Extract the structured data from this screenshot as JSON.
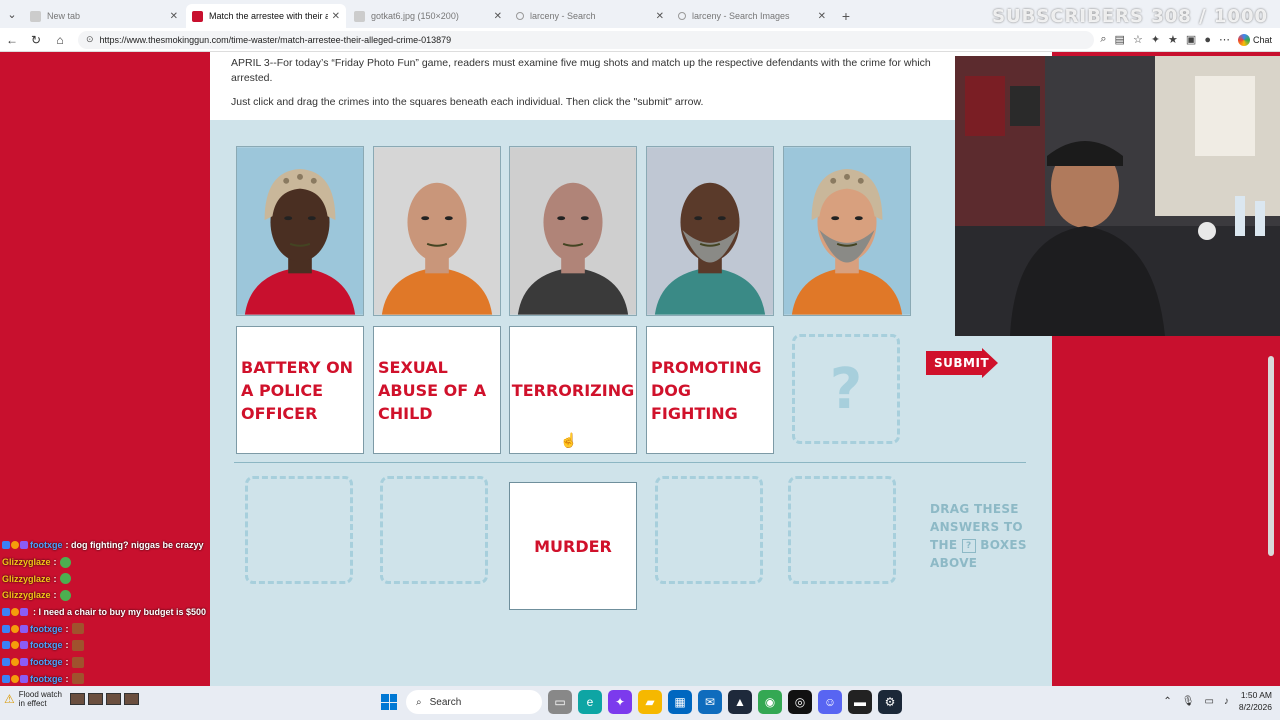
{
  "browser": {
    "tabs": [
      {
        "label": "New tab",
        "icon": "blank-page-icon",
        "active": false
      },
      {
        "label": "Match the arrestee with their alleg",
        "icon": "tsg-favicon",
        "active": true
      },
      {
        "label": "gotkat6.jpg (150×200)",
        "icon": "image-icon",
        "active": false
      },
      {
        "label": "larceny - Search",
        "icon": "search-icon",
        "active": false
      },
      {
        "label": "larceny - Search Images",
        "icon": "search-icon",
        "active": false
      }
    ],
    "url": "https://www.thesmokinggun.com/time-waster/match-arrestee-their-alleged-crime-013879",
    "chat_label": "Chat"
  },
  "stream_overlay": {
    "subscribers": "SUBSCRIBERS 308 / 1000"
  },
  "article": {
    "intro": "APRIL 3--For today’s “Friday Photo Fun” game, readers must examine five mug shots and match up the respective defendants with the crime for which arrested.",
    "instructions": "Just click and drag the crimes into the squares beneath each individual. Then click the \"submit\" arrow."
  },
  "game": {
    "mugshots": [
      {
        "name": "mugshot-1",
        "background": "#9cc6da",
        "skin": "#4a2f22",
        "shirt": "#c8102e",
        "helmet": true,
        "beard": false
      },
      {
        "name": "mugshot-2",
        "background": "#d6d6d6",
        "skin": "#c9967a",
        "shirt": "#e07828",
        "helmet": false,
        "beard": false
      },
      {
        "name": "mugshot-3",
        "background": "#cfcfcf",
        "skin": "#b08478",
        "shirt": "#3a3a3a",
        "helmet": false,
        "beard": false
      },
      {
        "name": "mugshot-4",
        "background": "#bfc7d3",
        "skin": "#5a3a2a",
        "shirt": "#3a8a86",
        "helmet": false,
        "beard": true
      },
      {
        "name": "mugshot-5",
        "background": "#9cc6da",
        "skin": "#d8a07e",
        "shirt": "#e07828",
        "helmet": true,
        "beard": true
      }
    ],
    "crimes": [
      "BATTERY ON A POLICE OFFICER",
      "SEXUAL ABUSE OF A CHILD",
      "TERRORIZING",
      "PROMOTING DOG FIGHTING"
    ],
    "question_mark": "?",
    "submit_label": "SUBMIT",
    "remaining_answer": "MURDER",
    "drag_hint_1": "DRAG THESE ANSWERS TO",
    "drag_hint_2": "THE",
    "drag_hint_box": "?",
    "drag_hint_3": "BOXES ABOVE"
  },
  "chat": [
    {
      "user": "footxge",
      "user_color": "#4aa3ff",
      "message": ": dog fighting? niggas be crazyy",
      "badges": true,
      "emote": null
    },
    {
      "user": "Glizzyglaze",
      "user_color": "#f5c518",
      "message": ":",
      "badges": false,
      "emote": "green"
    },
    {
      "user": "Glizzyglaze",
      "user_color": "#f5c518",
      "message": ":",
      "badges": false,
      "emote": "green"
    },
    {
      "user": "Glizzyglaze",
      "user_color": "#f5c518",
      "message": ":",
      "badges": false,
      "emote": "green"
    },
    {
      "user": "",
      "user_color": "#ff3b3b",
      "message": ": I need a chair to buy my budget is $500",
      "badges": true,
      "emote": null
    },
    {
      "user": "footxge",
      "user_color": "#4aa3ff",
      "message": ":",
      "badges": true,
      "emote": "face"
    },
    {
      "user": "footxge",
      "user_color": "#4aa3ff",
      "message": ":",
      "badges": true,
      "emote": "face"
    },
    {
      "user": "footxge",
      "user_color": "#4aa3ff",
      "message": ":",
      "badges": true,
      "emote": "face"
    },
    {
      "user": "footxge",
      "user_color": "#4aa3ff",
      "message": ":",
      "badges": true,
      "emote": "face"
    }
  ],
  "taskbar": {
    "search_placeholder": "Search",
    "notif_1": "Flood watch",
    "notif_2": "in effect",
    "time": "1:50 AM",
    "date": "8/2/2026"
  }
}
